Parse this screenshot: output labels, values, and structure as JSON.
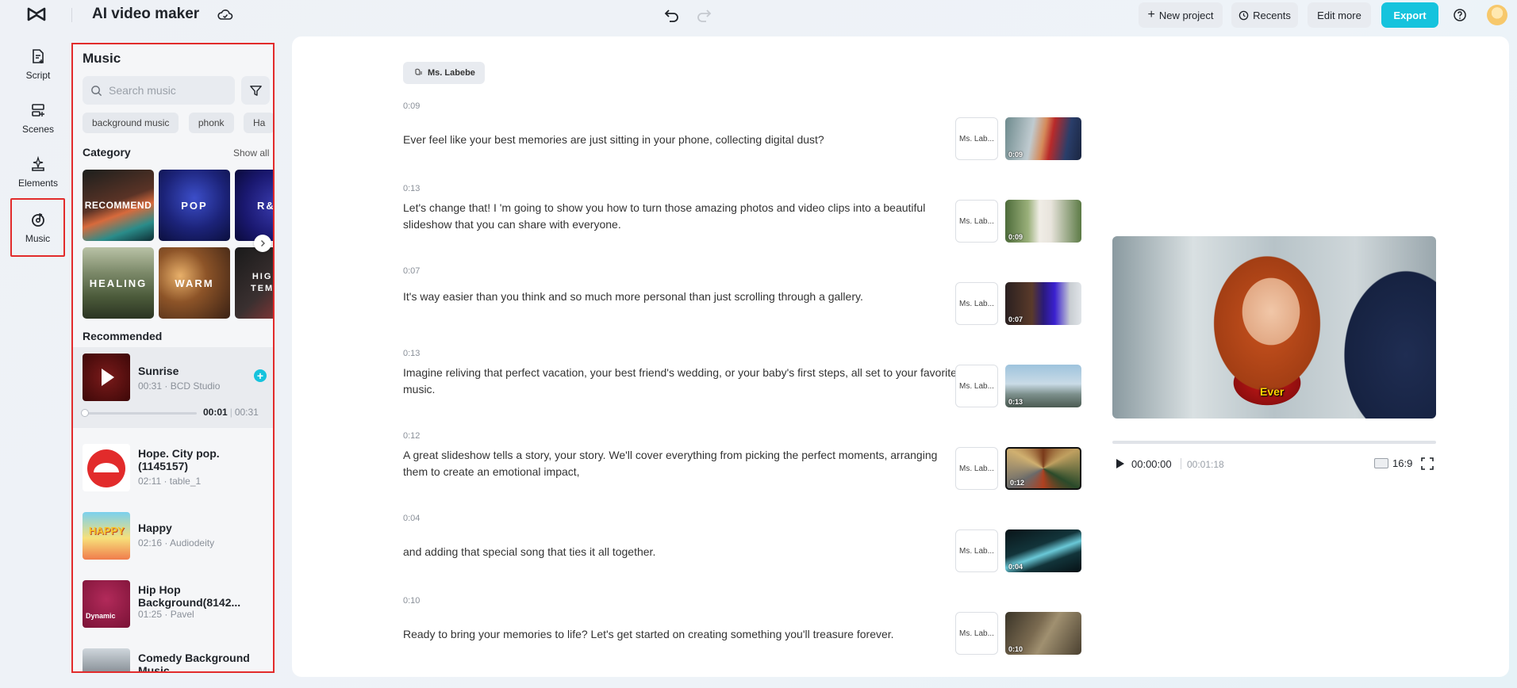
{
  "app": {
    "title": "AI video maker"
  },
  "toolbar": {
    "new_project": "New project",
    "recents": "Recents",
    "edit_more": "Edit more",
    "export": "Export"
  },
  "nav": {
    "items": [
      {
        "label": "Script"
      },
      {
        "label": "Scenes"
      },
      {
        "label": "Elements"
      },
      {
        "label": "Music"
      }
    ]
  },
  "music": {
    "title": "Music",
    "search_placeholder": "Search music",
    "chips": [
      "background music",
      "phonk",
      "Ha"
    ],
    "category_title": "Category",
    "show_all": "Show all",
    "categories": [
      "RECOMMEND",
      "POP",
      "R&",
      "HEALING",
      "WARM",
      "HIG\nTEM"
    ],
    "recommended_title": "Recommended",
    "tracks": [
      {
        "name": "Sunrise",
        "meta": "00:31 · BCD Studio",
        "current": "00:01",
        "duration": "00:31"
      },
      {
        "name": "Hope. City pop. (1145157)",
        "meta": "02:11 · table_1"
      },
      {
        "name": "Happy",
        "meta": "02:16 · Audiodeity",
        "thumb_text": "HAPPY"
      },
      {
        "name": "Hip Hop Background(8142...",
        "meta": "01:25 · Pavel",
        "thumb_text": "Dynamic"
      },
      {
        "name": "Comedy Background Music",
        "meta": ""
      }
    ]
  },
  "script": {
    "voice": "Ms. Labebe",
    "voice_short": "Ms. Lab...",
    "scenes": [
      {
        "time": "0:09",
        "text": "Ever feel like your best memories are just sitting in your phone, collecting digital dust?",
        "dur": "0:09"
      },
      {
        "time": "0:13",
        "text": "Let's change that! I 'm going to show you how to turn those amazing photos and video clips into a beautiful slideshow that you can share with everyone.",
        "dur": "0:09"
      },
      {
        "time": "0:07",
        "text": "It's way easier than you think and so much more personal than just scrolling through a gallery.",
        "dur": "0:07"
      },
      {
        "time": "0:13",
        "text": "Imagine reliving that perfect vacation, your best friend's wedding, or your baby's first steps, all set to your favorite music.",
        "dur": "0:13"
      },
      {
        "time": "0:12",
        "text": "A great slideshow tells a story, your story. We'll cover everything from picking the perfect moments, arranging them to create an emotional impact,",
        "dur": "0:12"
      },
      {
        "time": "0:04",
        "text": "and adding that special song that ties it all together.",
        "dur": "0:04"
      },
      {
        "time": "0:10",
        "text": "Ready to bring your memories to life? Let's get started on creating something you'll treasure forever.",
        "dur": "0:10"
      }
    ]
  },
  "preview": {
    "caption": "Ever",
    "current_time": "00:00:00",
    "total_time": "00:01:18",
    "ratio": "16:9"
  },
  "colors": {
    "accent": "#16c3dd",
    "highlight": "#e22b2b"
  }
}
